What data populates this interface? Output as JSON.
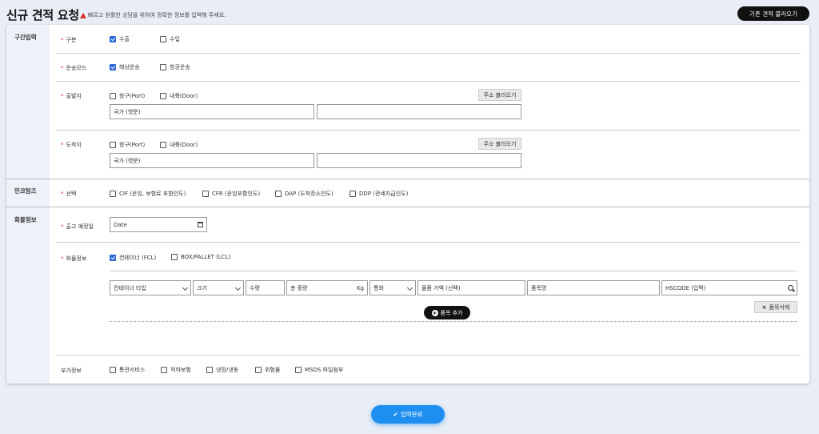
{
  "header": {
    "title": "신규 견적 요청",
    "notice": "빠르고 원활한 상담을 위하여 정확한 정보를 입력해 주세요.",
    "load_button": "기존 견적 불러오기"
  },
  "sections": {
    "route": "구간입력",
    "incoterms": "인코텀즈",
    "cargo": "화물정보"
  },
  "route": {
    "type_label": "구분",
    "export_label": "수출",
    "import_label": "수입",
    "transport_label": "운송모드",
    "sea_label": "해상운송",
    "air_label": "항공운송",
    "origin_label": "출발지",
    "dest_label": "도착지",
    "port_label": "항구(Port)",
    "door_label": "내륙(Door)",
    "address_button": "주소 불러오기",
    "country_placeholder": "국가 (영문)"
  },
  "incoterms": {
    "label": "선택",
    "options": [
      "CIF (운임, 보험료 포함인도)",
      "CFR (운임포함인도)",
      "DAP (도착장소인도)",
      "DDP (관세지급인도)"
    ]
  },
  "cargo": {
    "date_label": "출고 예정일",
    "date_placeholder": "Date",
    "info_label": "화물정보",
    "fcl_label": "컨테이너 (FCL)",
    "lcl_label": "BOX/PALLET (LCL)",
    "container_type": "컨테이너 타입",
    "size": "크기",
    "qty": "수량",
    "weight": "총 중량",
    "weight_unit": "Kg",
    "currency": "통화",
    "value": "물품 가액 (선택)",
    "item_name": "품목명",
    "hscode": "HSCODE (입력)",
    "delete_button": "품목삭제",
    "add_button": "품목 추가"
  },
  "extra": {
    "label": "부가정보",
    "options": [
      "통관서비스",
      "적하보험",
      "냉장/냉동",
      "위험물",
      "MSDS 파일첨부"
    ]
  },
  "submit": "입력완료"
}
